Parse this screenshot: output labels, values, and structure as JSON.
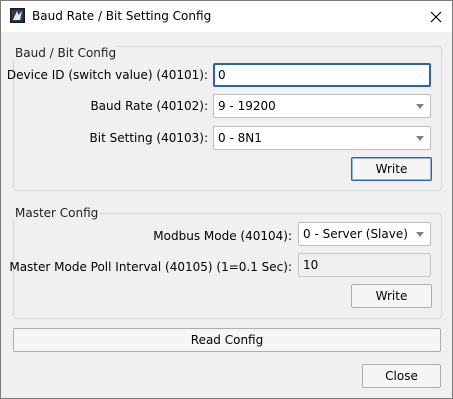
{
  "window": {
    "title": "Baud Rate / Bit Setting Config"
  },
  "baud_group": {
    "legend": "Baud / Bit Config",
    "device_id_label": "Device ID (switch value) (40101):",
    "device_id_value": "0",
    "baud_rate_label": "Baud Rate (40102):",
    "baud_rate_value": "9 - 19200",
    "bit_setting_label": "Bit Setting (40103):",
    "bit_setting_value": "0 - 8N1",
    "write_label": "Write"
  },
  "master_group": {
    "legend": "Master Config",
    "modbus_mode_label": "Modbus Mode (40104):",
    "modbus_mode_value": "0 - Server (Slave)",
    "poll_interval_label": "Master Mode Poll Interval (40105) (1=0.1 Sec):",
    "poll_interval_value": "10",
    "write_label": "Write"
  },
  "footer": {
    "read_config_label": "Read Config",
    "close_label": "Close"
  },
  "icons": {
    "app": "app-icon",
    "close": "close-icon",
    "dropdown": "chevron-down-icon"
  },
  "colors": {
    "focus_border": "#2b62a8",
    "window_bg": "#f0f0f0"
  }
}
